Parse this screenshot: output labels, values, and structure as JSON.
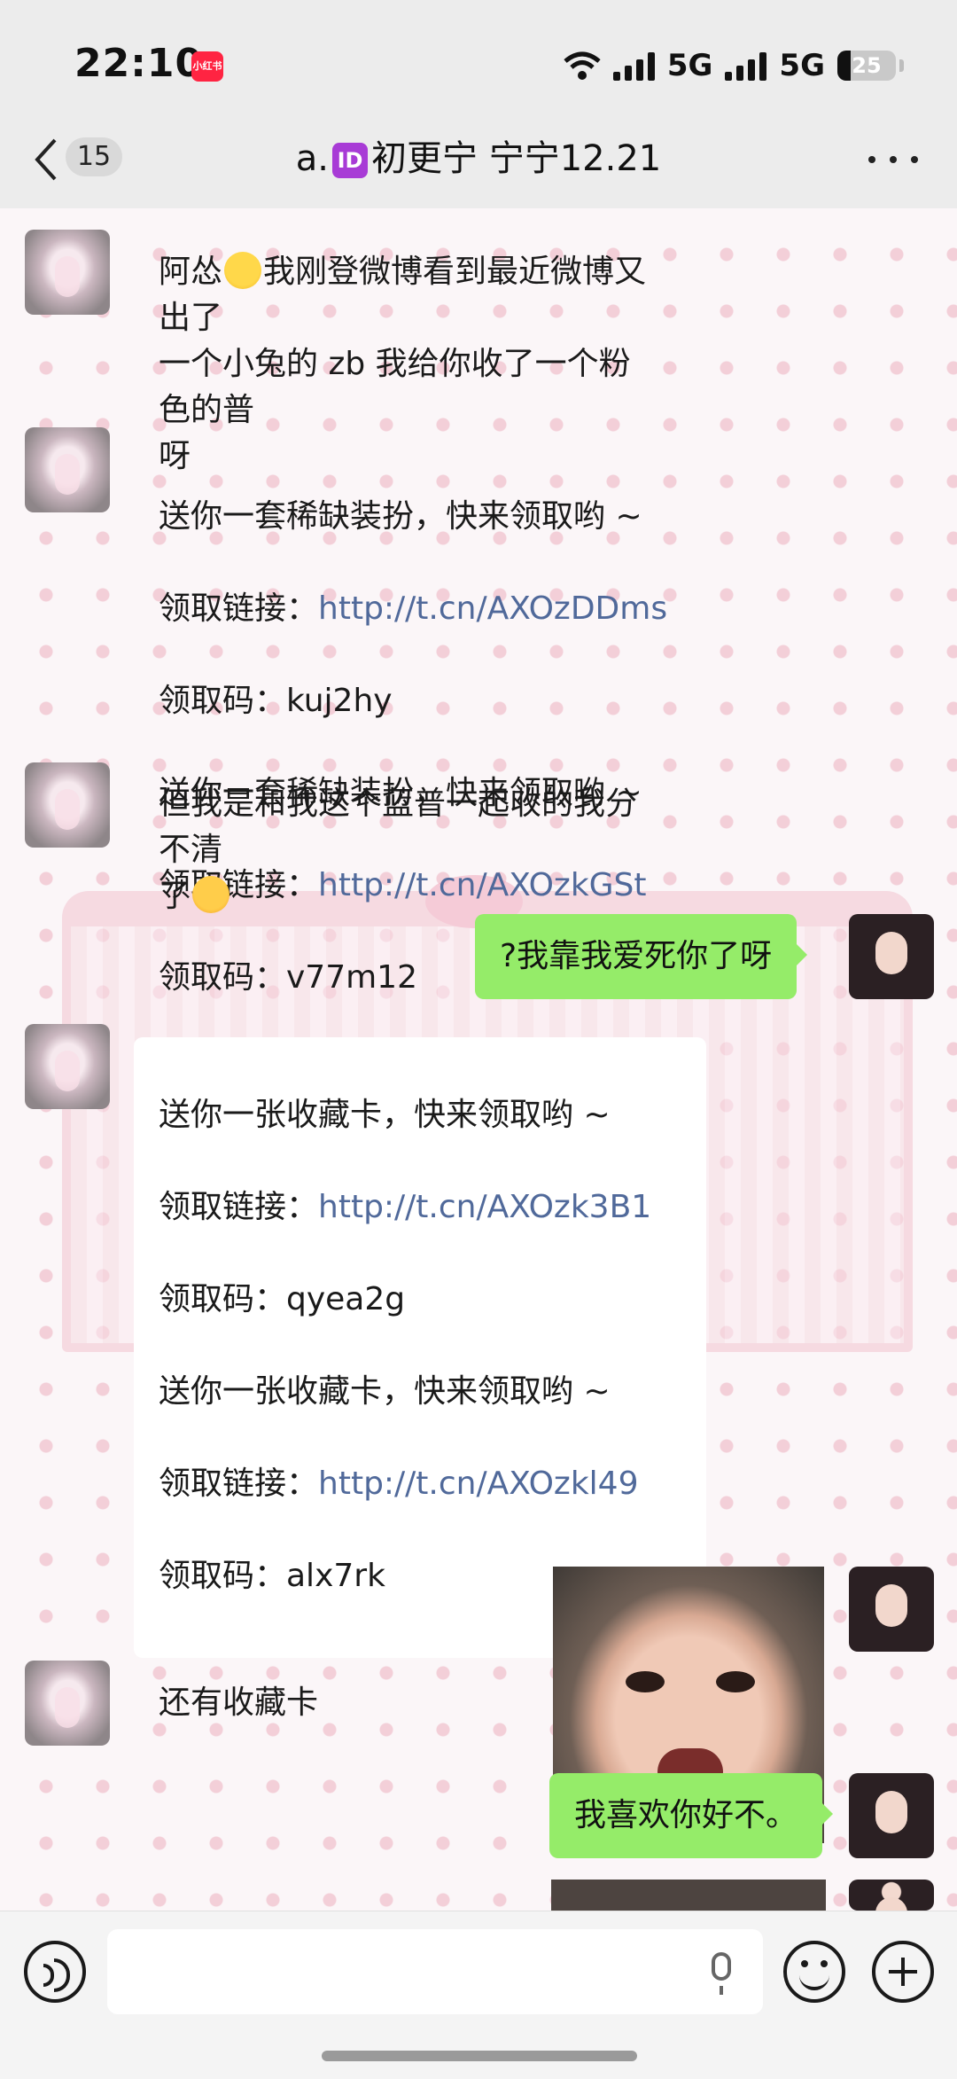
{
  "status_bar": {
    "time": "22:10",
    "app_badge": "小红书",
    "network_1": "5G",
    "network_2": "5G",
    "battery": "25"
  },
  "nav": {
    "unread_count": "15",
    "title_prefix": "a.",
    "title_chip": "ID",
    "title_suffix": "初更宁 宁宁12.21"
  },
  "messages": {
    "m1": {
      "before": "阿怂",
      "after": "我刚登微博看到最近微博又出了\n一个小兔的 zb 我给你收了一个粉色的普\n呀"
    },
    "m2": {
      "line1": "送你一套稀缺装扮，快来领取哟 ~",
      "label_link": "领取链接：",
      "link1": "http://t.cn/AXOzDDms",
      "code1": "领取码：kuj2hy",
      "line4": "送你一套稀缺装扮，快来领取哟 ~",
      "link2": "http://t.cn/AXOzkGSt",
      "code2": "领取码：v77m12"
    },
    "m3": {
      "before": "但我是和我这个蓝普一起收的我分不清\n了"
    },
    "m4": {
      "text": "?我靠我爱死你了呀"
    },
    "m5": {
      "line1": "送你一张收藏卡，快来领取哟 ~",
      "label_link": "领取链接：",
      "link1": "http://t.cn/AXOzk3B1",
      "code1": "领取码：qyea2g",
      "line4": "送你一张收藏卡，快来领取哟 ~",
      "link2": "http://t.cn/AXOzkl49",
      "code2": "领取码：alx7rk"
    },
    "m7": {
      "text": "还有收藏卡"
    },
    "m8": {
      "text": "我喜欢你好不。"
    }
  },
  "input_bar": {
    "placeholder": ""
  },
  "colors": {
    "my_bubble": "#95ec69",
    "link": "#50699a",
    "accent_badge": "#ff2442"
  }
}
